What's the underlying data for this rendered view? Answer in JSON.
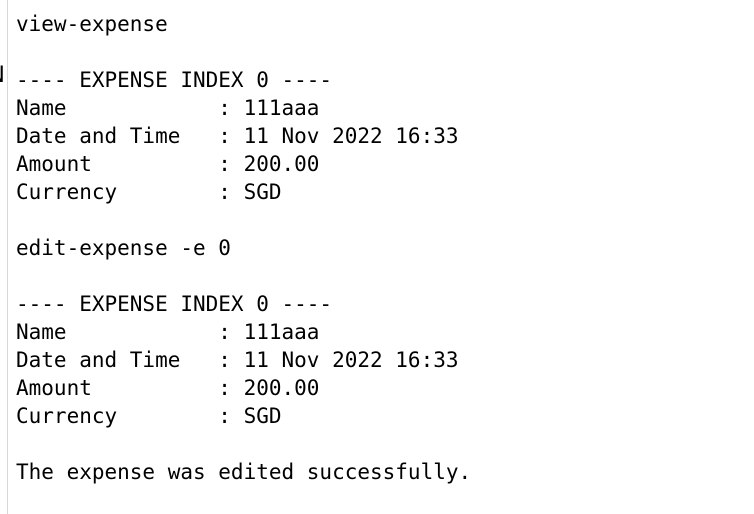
{
  "terminal": {
    "lines": [
      "view-expense",
      "",
      "---- EXPENSE INDEX 0 ----",
      "Name            : 111aaa",
      "Date and Time   : 11 Nov 2022 16:33",
      "Amount          : 200.00",
      "Currency        : SGD",
      "",
      "edit-expense -e 0",
      "",
      "---- EXPENSE INDEX 0 ----",
      "Name            : 111aaa",
      "Date and Time   : 11 Nov 2022 16:33",
      "Amount          : 200.00",
      "Currency        : SGD",
      "",
      "The expense was edited successfully."
    ]
  },
  "edge_fragment": "N"
}
